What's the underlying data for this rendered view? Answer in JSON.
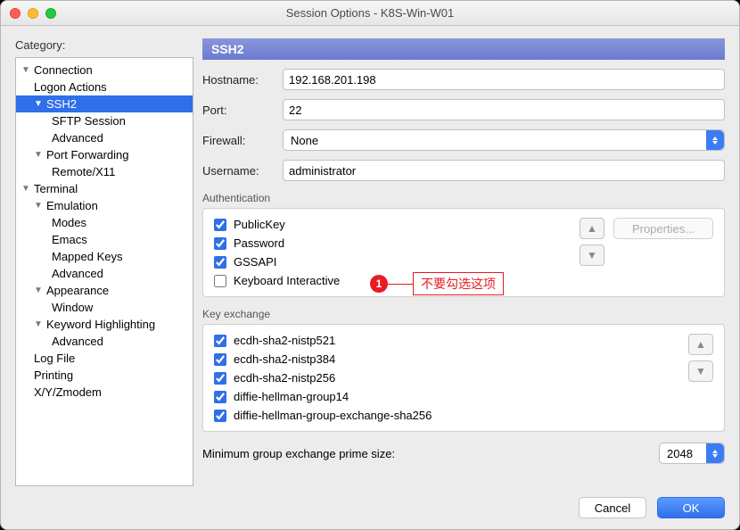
{
  "window": {
    "title": "Session Options - K8S-Win-W01"
  },
  "category_label": "Category:",
  "tree": {
    "connection": "Connection",
    "logon_actions": "Logon Actions",
    "ssh2": "SSH2",
    "sftp_session": "SFTP Session",
    "advanced": "Advanced",
    "port_forwarding": "Port Forwarding",
    "remote_x11": "Remote/X11",
    "terminal": "Terminal",
    "emulation": "Emulation",
    "modes": "Modes",
    "emacs": "Emacs",
    "mapped_keys": "Mapped Keys",
    "advanced2": "Advanced",
    "appearance": "Appearance",
    "window": "Window",
    "keyword_highlighting": "Keyword Highlighting",
    "advanced3": "Advanced",
    "log_file": "Log File",
    "printing": "Printing",
    "xyzmodem": "X/Y/Zmodem"
  },
  "section_title": "SSH2",
  "fields": {
    "hostname_label": "Hostname:",
    "hostname_value": "192.168.201.198",
    "port_label": "Port:",
    "port_value": "22",
    "firewall_label": "Firewall:",
    "firewall_value": "None",
    "username_label": "Username:",
    "username_value": "administrator"
  },
  "auth": {
    "group_label": "Authentication",
    "publickey": "PublicKey",
    "password": "Password",
    "gssapi": "GSSAPI",
    "keyboard_interactive": "Keyboard Interactive",
    "properties_label": "Properties..."
  },
  "annotation": {
    "number": "1",
    "text": "不要勾选这项"
  },
  "kex": {
    "group_label": "Key exchange",
    "items": [
      "ecdh-sha2-nistp521",
      "ecdh-sha2-nistp384",
      "ecdh-sha2-nistp256",
      "diffie-hellman-group14",
      "diffie-hellman-group-exchange-sha256"
    ]
  },
  "min_group": {
    "label": "Minimum group exchange prime size:",
    "value": "2048"
  },
  "buttons": {
    "cancel": "Cancel",
    "ok": "OK"
  }
}
